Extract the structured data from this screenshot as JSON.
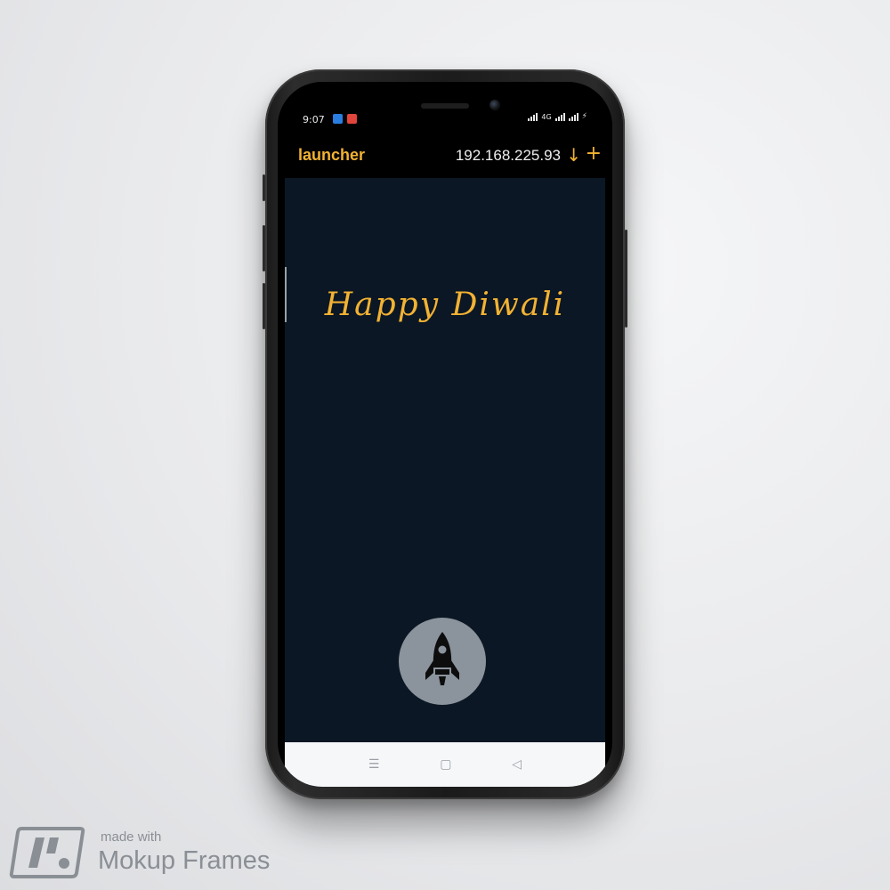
{
  "status_bar": {
    "time": "9:07",
    "network": "4G"
  },
  "app_bar": {
    "title": "launcher",
    "ip_address": "192.168.225.93"
  },
  "content": {
    "greeting": "Happy Diwali"
  },
  "icons": {
    "download": "arrow-down-icon",
    "add": "plus-icon",
    "launch": "rocket-icon",
    "nav_menu": "menu-icon",
    "nav_home": "home-square-icon",
    "nav_back": "back-triangle-icon"
  },
  "colors": {
    "accent": "#f2b233",
    "background": "#0b1724",
    "launch_button": "#8b939c"
  },
  "watermark": {
    "made_with": "made with",
    "brand": "Mokup Frames"
  }
}
